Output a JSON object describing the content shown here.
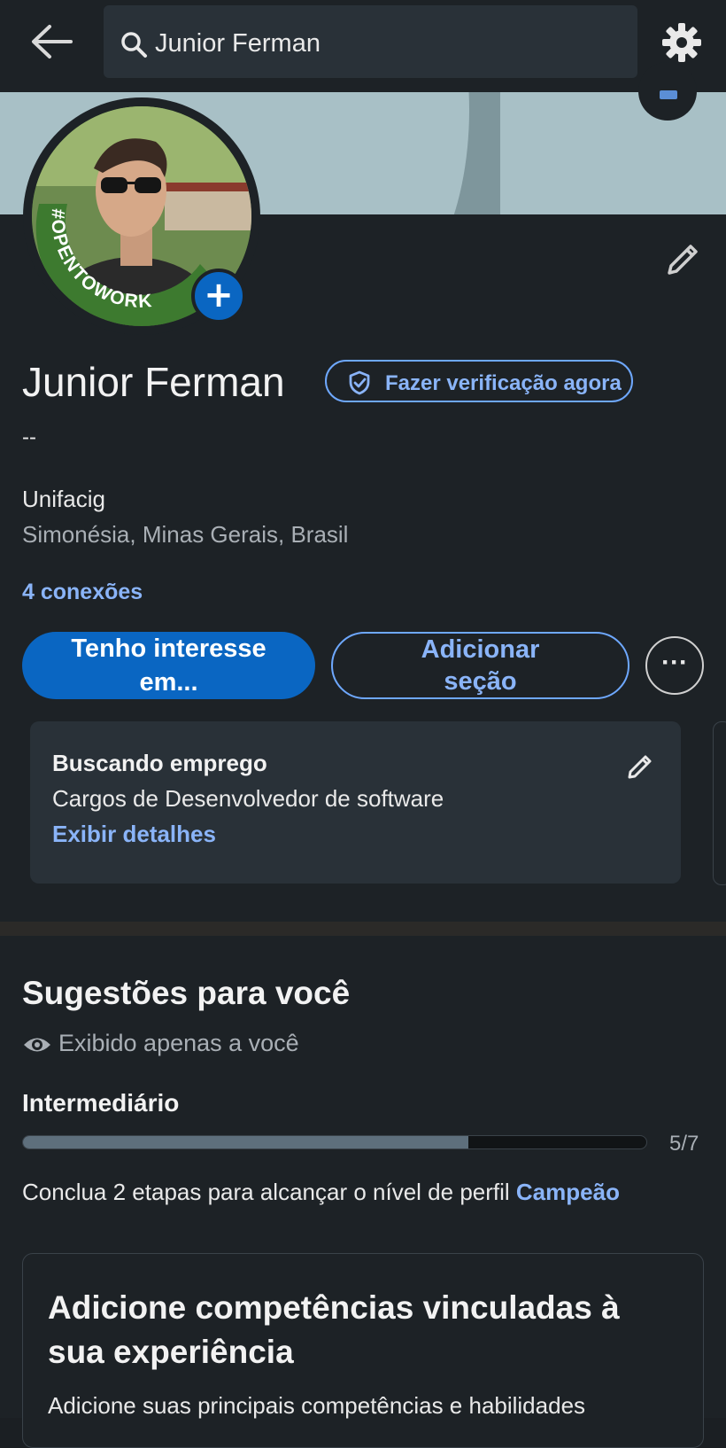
{
  "topbar": {
    "back_icon": "back-arrow-icon",
    "search_value": "Junior Ferman",
    "settings_icon": "gear-icon"
  },
  "profile": {
    "avatar_badge": "#OPENTOWORK",
    "name": "Junior Ferman",
    "verify_label": "Fazer verificação agora",
    "headline": "--",
    "school": "Unifacig",
    "location": "Simonésia, Minas Gerais, Brasil",
    "connections": "4 conexões",
    "btn_interest": "Tenho interesse em...",
    "btn_add_section": "Adicionar seção",
    "btn_more": "···"
  },
  "job_card": {
    "title": "Buscando emprego",
    "subtitle": "Cargos de Desenvolvedor de software",
    "link": "Exibir detalhes"
  },
  "suggestions": {
    "title": "Sugestões para você",
    "visibility": "Exibido apenas a você",
    "level_label": "Intermediário",
    "progress_text": "5/7",
    "progress_value": 0.714,
    "conclude_prefix": "Conclua 2 etapas para alcançar o nível de perfil ",
    "conclude_link": "Campeão",
    "card_title": "Adicione competências vinculadas à sua experiência",
    "card_desc": "Adicione suas principais competências e habilidades"
  },
  "colors": {
    "accent": "#0a66c2",
    "link": "#8ab4f8",
    "open_to_work": "#3d7a2f"
  }
}
